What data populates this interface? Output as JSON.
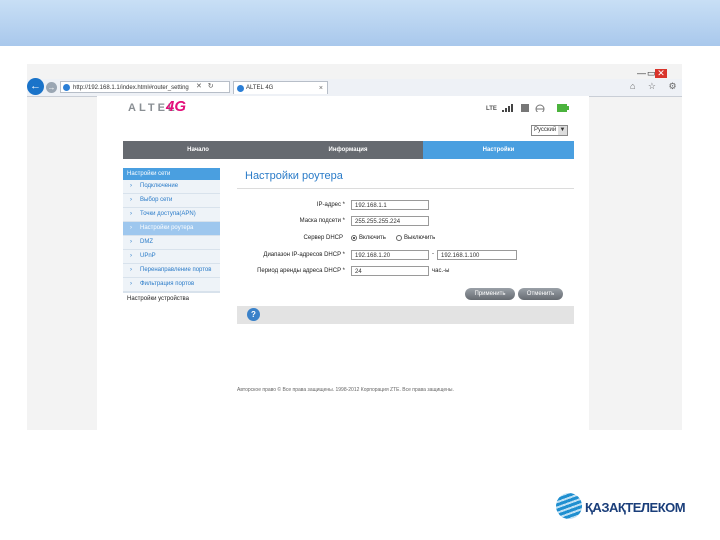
{
  "window": {
    "minimize": "—",
    "restore": "▭",
    "close": "✕"
  },
  "browser": {
    "back": "←",
    "forward": "→",
    "url": "http://192.168.1.1/index.html#router_setting",
    "url_tools": "✕ ↻",
    "tab_label": "ALTEL 4G",
    "tab_close": "×",
    "right_icons": "⌂ ☆ ⚙"
  },
  "header": {
    "logo_text": "ALTEL",
    "logo_4g": "4G",
    "network": "LTE",
    "language": "Русский"
  },
  "nav": {
    "items": [
      "Начало",
      "Информация",
      "Настройки"
    ],
    "active": 2
  },
  "sidebar": {
    "head": "Настройки сети",
    "items": [
      "Подключение",
      "Выбор сети",
      "Точки доступа(APN)",
      "Настройки роутера",
      "DMZ",
      "UPnP",
      "Перенаправление портов",
      "Фильтрация портов"
    ],
    "selected": 3,
    "footer": "Настройки устройства"
  },
  "form": {
    "title": "Настройки роутера",
    "ip_label": "IP-адрес *",
    "ip_value": "192.168.1.1",
    "mask_label": "Маска подсети *",
    "mask_value": "255.255.255.224",
    "dhcp_label": "Сервер DHCP",
    "dhcp_on": "Включить",
    "dhcp_off": "Выключить",
    "range_label": "Диапазон IP-адресов DHCP *",
    "range_from": "192.168.1.20",
    "range_sep": "-",
    "range_to": "192.168.1.100",
    "lease_label": "Период аренды адреса DHCP *",
    "lease_value": "24",
    "lease_unit": "час.-ы",
    "apply": "Применить",
    "cancel": "Отменить",
    "help": "?"
  },
  "footer": {
    "copyright": "Авторское право © Все права защищены. 1998-2012 Корпорация ZTE. Все права защищены."
  },
  "brand": {
    "name": "ҚАЗАҚТЕЛЕКОМ"
  },
  "colors": {
    "accent": "#4a9fe0",
    "nav": "#666a70",
    "brand": "#1a3e7a"
  }
}
